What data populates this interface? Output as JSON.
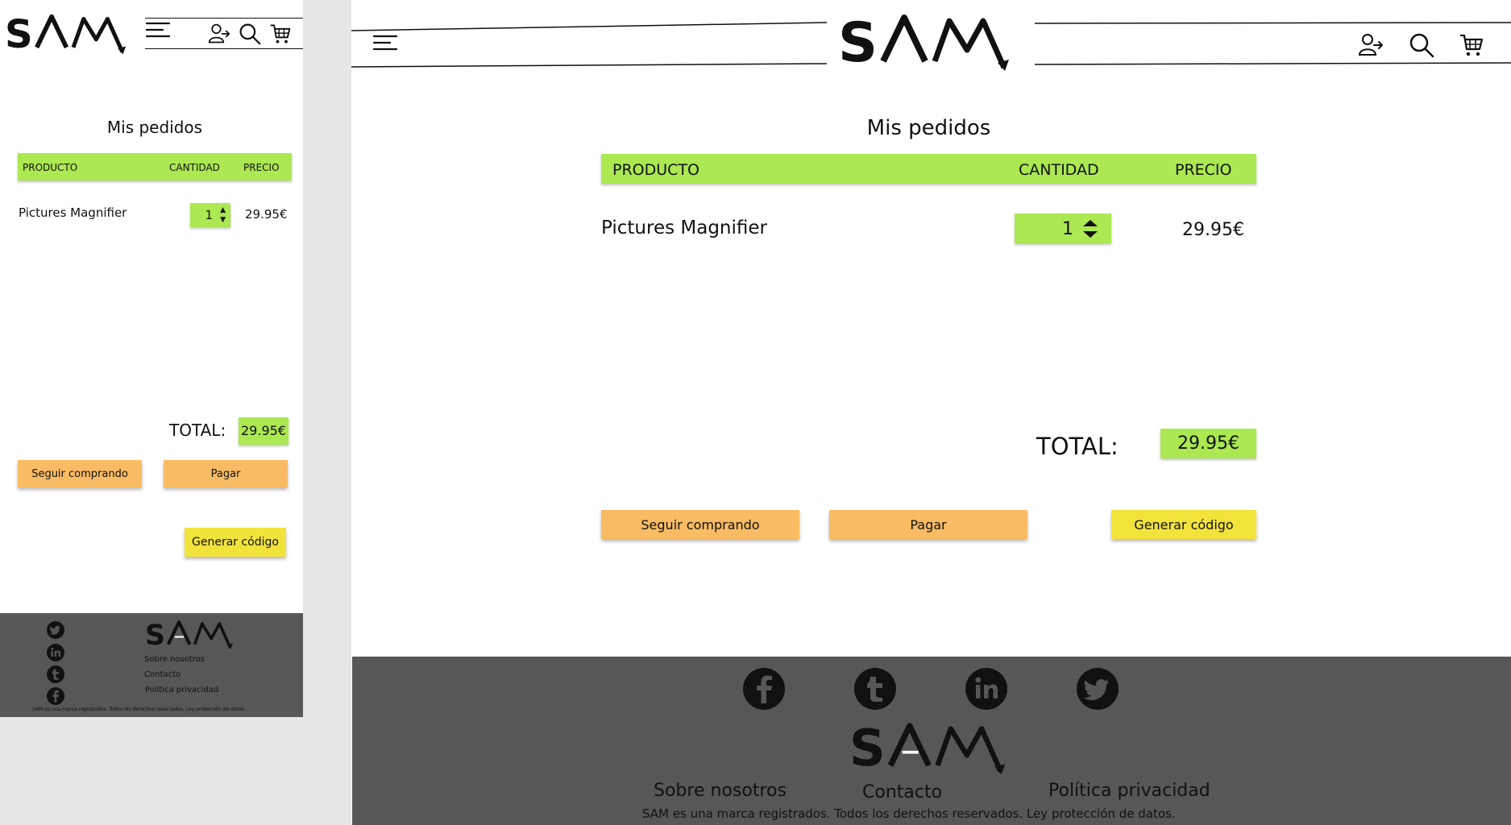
{
  "brand": {
    "logo_text": "SAM"
  },
  "header": {
    "icons": [
      "menu-icon",
      "user-login-icon",
      "search-icon",
      "cart-icon"
    ]
  },
  "orders": {
    "title": "Mis pedidos",
    "columns": {
      "product": "PRODUCTO",
      "quantity": "CANTIDAD",
      "price": "PRECIO"
    },
    "items": [
      {
        "product": "Pictures Magnifier",
        "quantity": "1",
        "price": "29.95€"
      }
    ],
    "total_label": "TOTAL:",
    "total_value": "29.95€"
  },
  "actions": {
    "continue_shopping": "Seguir comprando",
    "pay": "Pagar",
    "generate_code": "Generar código"
  },
  "footer": {
    "social": [
      "facebook-icon",
      "tumblr-icon",
      "linkedin-icon",
      "twitter-icon"
    ],
    "links": [
      "Sobre nosotros",
      "Contacto",
      "Política privacidad"
    ],
    "copyright": "SAM es una marca registrados. Todos los derechos reservados. Ley protección de datos."
  },
  "colors": {
    "accent_green": "#abe852",
    "button_orange": "#f9bb63",
    "button_yellow": "#f2e33b",
    "footer_bg": "#575757"
  }
}
